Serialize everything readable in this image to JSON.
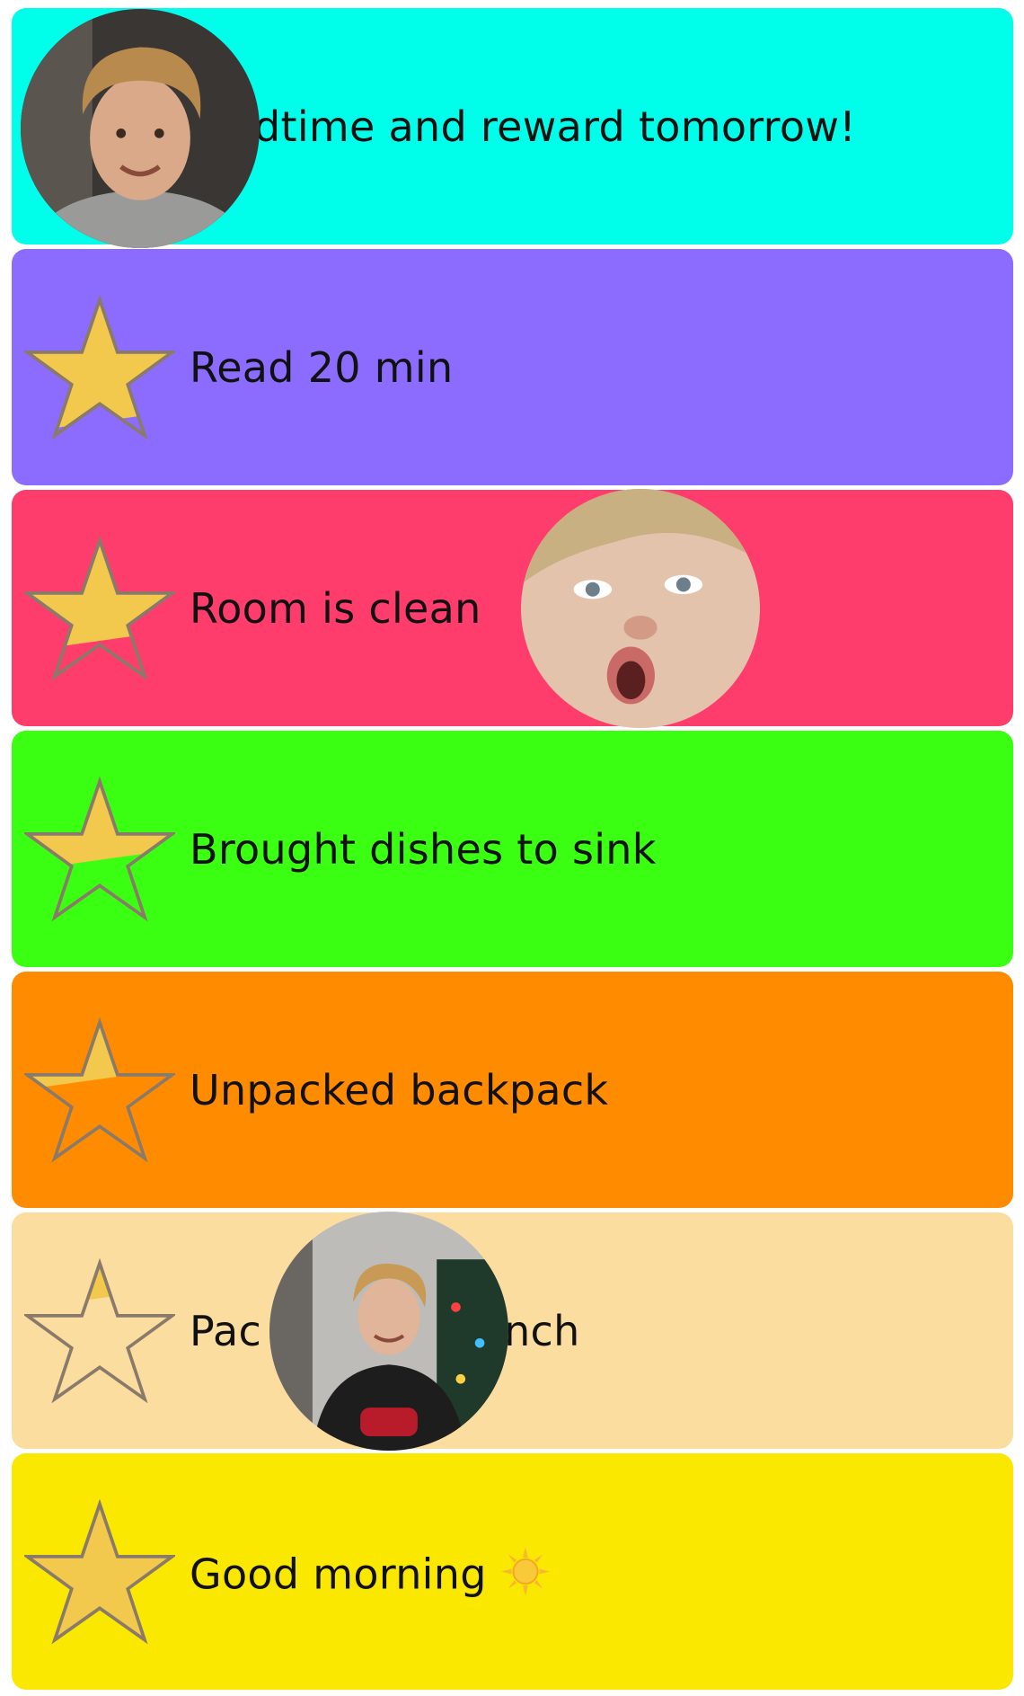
{
  "tasks": [
    {
      "label": "dtime and reward tomorrow!",
      "color": "#00FFEA",
      "fill_fraction": 1.0
    },
    {
      "label": "Read 20 min",
      "color": "#8B6CFF",
      "fill_fraction": 0.8
    },
    {
      "label": "Room is clean",
      "color": "#FF3D6C",
      "fill_fraction": 0.65
    },
    {
      "label": "Brought dishes to sink",
      "color": "#3BFF12",
      "fill_fraction": 0.5
    },
    {
      "label": "Unpacked backpack",
      "color": "#FF8C00",
      "fill_fraction": 0.35
    },
    {
      "label": "Pac",
      "label_tail": "nch",
      "color": "#FBDDA0",
      "fill_fraction": 0.2
    },
    {
      "label": "Good morning",
      "color": "#FBE800",
      "fill_fraction": 1.0
    }
  ],
  "icons": {
    "star": "star-icon",
    "sun": "sun-icon",
    "avatar": "child-avatar-photo"
  },
  "colors": {
    "star_fill": "#F2C94C",
    "star_outline": "#8A7A6A",
    "text": "#111111"
  }
}
